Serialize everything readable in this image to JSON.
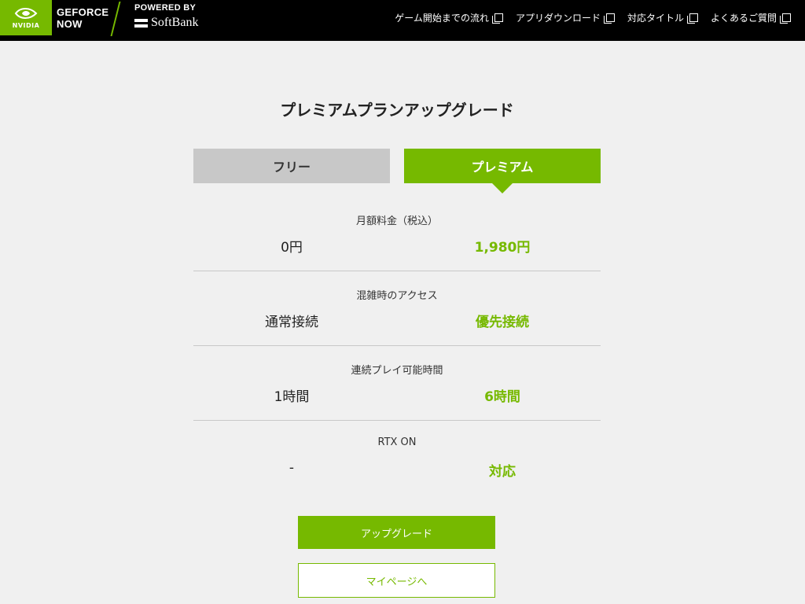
{
  "header": {
    "brand_nvidia": "NVIDIA",
    "brand_gfn_line1": "GEFORCE",
    "brand_gfn_line2": "NOW",
    "powered_by": "POWERED BY",
    "softbank": "SoftBank",
    "nav": [
      {
        "label": "ゲーム開始までの流れ",
        "icon": "external-link-icon"
      },
      {
        "label": "アプリダウンロード",
        "icon": "external-link-icon"
      },
      {
        "label": "対応タイトル",
        "icon": "external-link-icon"
      },
      {
        "label": "よくあるご質問",
        "icon": "external-link-icon"
      }
    ]
  },
  "main": {
    "title": "プレミアムプランアップグレード",
    "tabs": {
      "free": "フリー",
      "premium": "プレミアム"
    },
    "rows": [
      {
        "label": "月額料金（税込）",
        "free": "0円",
        "premium": "1,980円"
      },
      {
        "label": "混雑時のアクセス",
        "free": "通常接続",
        "premium": "優先接続"
      },
      {
        "label": "連続プレイ可能時間",
        "free": "1時間",
        "premium": "6時間"
      },
      {
        "label": "RTX ON",
        "free": "-",
        "premium": "対応"
      }
    ],
    "buttons": {
      "upgrade": "アップグレード",
      "mypage": "マイページへ"
    }
  },
  "colors": {
    "accent": "#76b900",
    "header_bg": "#000000",
    "page_bg": "#f0f0f0",
    "free_tab_bg": "#c8c8c8"
  }
}
